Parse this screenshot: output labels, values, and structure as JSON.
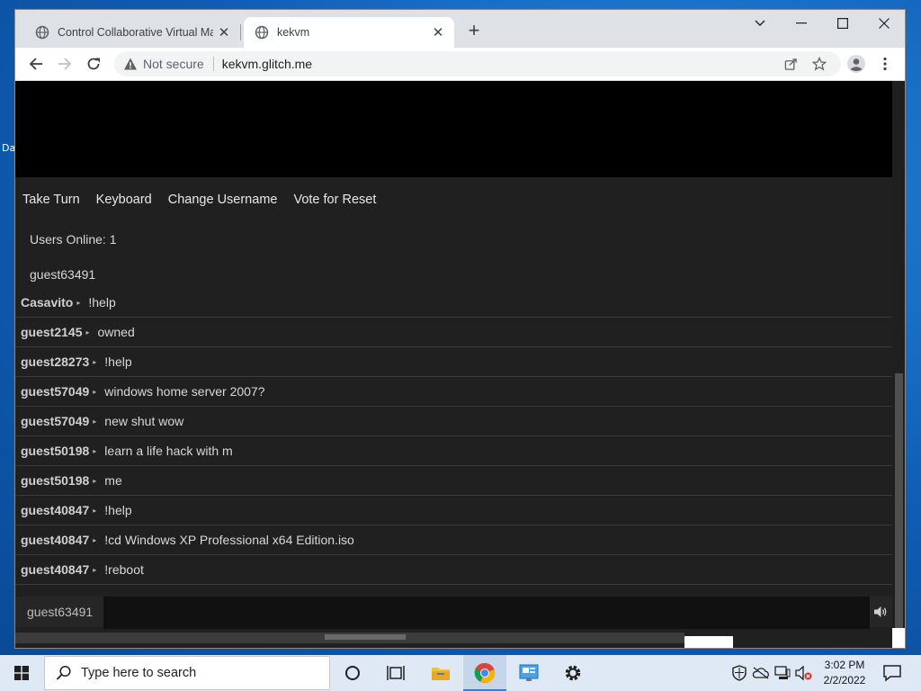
{
  "desktop": {
    "icon_label_fragment": "Da"
  },
  "browser": {
    "tabs": [
      {
        "title": "Control Collaborative Virtual Machines",
        "active": false
      },
      {
        "title": "kekvm",
        "active": true
      }
    ],
    "address": {
      "security": "Not secure",
      "url": "kekvm.glitch.me"
    },
    "icons": {
      "back": "back-arrow-icon",
      "forward": "forward-arrow-icon",
      "reload": "reload-icon",
      "share": "share-icon",
      "bookmark": "star-icon",
      "profile": "profile-icon",
      "menu": "kebab-menu-icon"
    }
  },
  "page": {
    "actions": [
      "Take Turn",
      "Keyboard",
      "Change Username",
      "Vote for Reset"
    ],
    "users_online_label": "Users Online: 1",
    "online_users": [
      "guest63491"
    ],
    "chat": [
      {
        "user": "Casavito",
        "text": "!help"
      },
      {
        "user": "guest2145",
        "text": "owned"
      },
      {
        "user": "guest28273",
        "text": "!help"
      },
      {
        "user": "guest57049",
        "text": "windows home server 2007?"
      },
      {
        "user": "guest57049",
        "text": "new shut wow"
      },
      {
        "user": "guest50198",
        "text": "learn a life hack with m"
      },
      {
        "user": "guest50198",
        "text": "me"
      },
      {
        "user": "guest40847",
        "text": "!help"
      },
      {
        "user": "guest40847",
        "text": "!cd Windows XP Professional x64 Edition.iso"
      },
      {
        "user": "guest40847",
        "text": "!reboot"
      }
    ],
    "chat_username": "guest63491",
    "chat_input_value": ""
  },
  "taskbar": {
    "search_placeholder": "Type here to search",
    "clock_time": "3:02 PM",
    "clock_date": "2/2/2022"
  },
  "colors": {
    "page_bg": "#202020",
    "chrome_tabstrip": "#dee1e6",
    "desktop_blue": "#0f5db5",
    "taskbar": "#dfe9f5"
  }
}
